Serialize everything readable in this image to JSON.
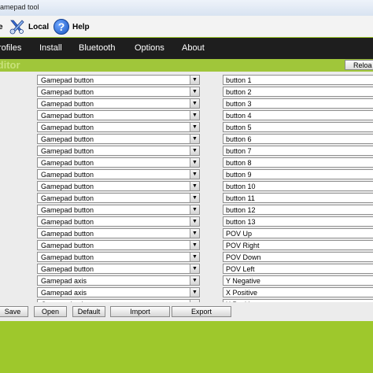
{
  "window": {
    "title": "y Gamepad tool"
  },
  "toolbar": {
    "items": [
      {
        "label": "e",
        "icon": "clipped-icon"
      },
      {
        "label": "Local",
        "icon": "local-tools-icon"
      },
      {
        "label": "Help",
        "icon": "help-icon"
      }
    ]
  },
  "menu": {
    "items": [
      {
        "label": "rofiles"
      },
      {
        "label": "Install"
      },
      {
        "label": "Bluetooth"
      },
      {
        "label": "Options"
      },
      {
        "label": "About"
      }
    ]
  },
  "editor": {
    "title": "Editor",
    "reload_label": "Reloa",
    "rows": [
      {
        "type": "Gamepad button",
        "name": "button 1"
      },
      {
        "type": "Gamepad button",
        "name": "button 2"
      },
      {
        "type": "Gamepad button",
        "name": "button 3"
      },
      {
        "type": "Gamepad button",
        "name": "button 4"
      },
      {
        "type": "Gamepad button",
        "name": "button 5"
      },
      {
        "type": "Gamepad button",
        "name": "button 6"
      },
      {
        "type": "Gamepad button",
        "name": "button 7"
      },
      {
        "type": "Gamepad button",
        "name": "button 8"
      },
      {
        "type": "Gamepad button",
        "name": "button 9"
      },
      {
        "type": "Gamepad button",
        "name": "button 10"
      },
      {
        "type": "Gamepad button",
        "name": "button 11"
      },
      {
        "type": "Gamepad button",
        "name": "button 12"
      },
      {
        "type": "Gamepad button",
        "name": "button 13"
      },
      {
        "type": "Gamepad button",
        "name": "POV Up"
      },
      {
        "type": "Gamepad button",
        "name": "POV Right"
      },
      {
        "type": "Gamepad button",
        "name": "POV Down"
      },
      {
        "type": "Gamepad button",
        "name": "POV Left"
      },
      {
        "type": "Gamepad axis",
        "name": "Y Negative"
      },
      {
        "type": "Gamepad axis",
        "name": "X Positive"
      },
      {
        "type": "Gamepad axis",
        "name": "X Positive"
      }
    ]
  },
  "buttons": {
    "save": "Save",
    "open": "Open",
    "default": "Default",
    "import": "Import",
    "export": "Export"
  },
  "colors": {
    "background_green": "#9ec82c",
    "menu_bar": "#1e1e1e",
    "editor_title": "#c8e27a"
  }
}
